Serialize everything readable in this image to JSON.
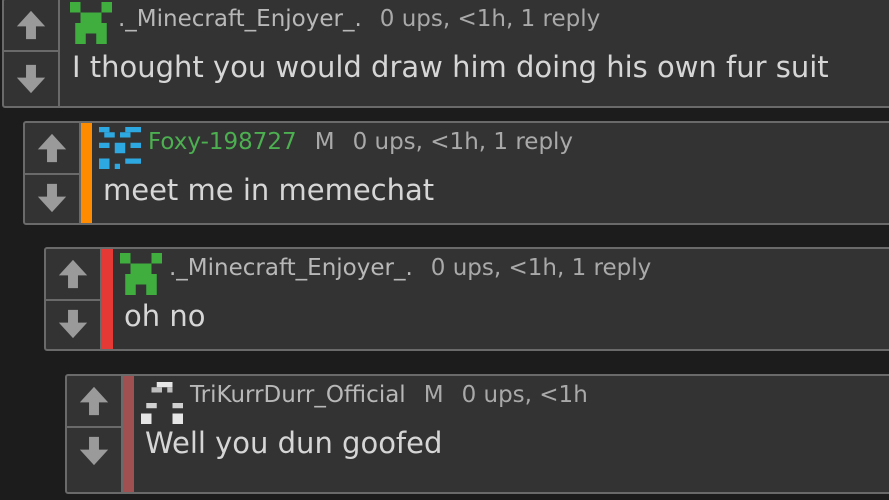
{
  "comments": [
    {
      "user": "._Minecraft_Enjoyer_.",
      "user_color": "#b8b8b8",
      "flair": "",
      "meta": "0 ups, <1h, 1 reply",
      "text": "I thought you would draw him doing his own fur suit",
      "accent_color": "",
      "avatar_icon": "creeper-avatar-icon"
    },
    {
      "user": "Foxy-198727",
      "user_color": "#4caf50",
      "flair": "M",
      "meta": "0 ups, <1h, 1 reply",
      "text": "meet me in memechat",
      "accent_color": "#ff8c00",
      "avatar_icon": "blue-pixel-avatar-icon"
    },
    {
      "user": "._Minecraft_Enjoyer_.",
      "user_color": "#b8b8b8",
      "flair": "",
      "meta": "0 ups, <1h, 1 reply",
      "text": "oh no",
      "accent_color": "#e53935",
      "avatar_icon": "creeper-avatar-icon"
    },
    {
      "user": "TriKurrDurr_Official",
      "user_color": "#b8b8b8",
      "flair": "M",
      "meta": "0 ups, <1h",
      "text": "Well you dun goofed",
      "accent_color": "#a05050",
      "avatar_icon": "white-pixel-avatar-icon"
    }
  ]
}
